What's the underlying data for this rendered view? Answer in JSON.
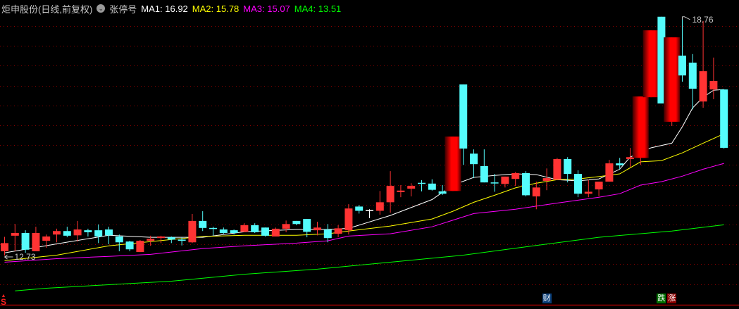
{
  "header": {
    "title": "炬申股份(日线,前复权)",
    "dropdown_icon": "chevron-down-icon",
    "indicator": "张停号",
    "ma_labels": [
      {
        "label": "MA1: 16.92",
        "color": "#ffffff"
      },
      {
        "label": "MA2: 15.78",
        "color": "#ffff00"
      },
      {
        "label": "MA3: 15.07",
        "color": "#ff00ff"
      },
      {
        "label": "MA4: 13.51",
        "color": "#00ff00"
      }
    ]
  },
  "labels": {
    "high": "18.76",
    "low": "12.73"
  },
  "markers": [
    {
      "text": "S",
      "candle": 0,
      "color": "#ff2020"
    },
    {
      "text": "财",
      "candle": 52,
      "color": "#0a3f7a"
    },
    {
      "text": "跌",
      "candle": 63,
      "color": "#007000"
    },
    {
      "text": "涨",
      "candle": 64,
      "color": "#8a0000"
    }
  ],
  "chart_data": {
    "type": "candlestick",
    "title": "炬申股份(日线,前复权)",
    "ylim": [
      11.79,
      19.3
    ],
    "grid": true,
    "colors": {
      "up": "#ff3333",
      "down": "#54fcfc",
      "flat": "#ffffff"
    },
    "high_label": "18.76",
    "low_label": "12.73",
    "limit_up_indices": [
      43,
      61,
      62,
      64
    ],
    "candles_ohlc": [
      [
        12.84,
        13.21,
        12.73,
        13.05
      ],
      [
        13.24,
        13.54,
        12.84,
        13.31
      ],
      [
        13.31,
        13.38,
        12.8,
        12.88
      ],
      [
        12.84,
        13.47,
        12.84,
        13.31
      ],
      [
        13.11,
        13.27,
        12.93,
        13.22
      ],
      [
        13.27,
        13.42,
        13.07,
        13.36
      ],
      [
        13.36,
        13.47,
        13.2,
        13.24
      ],
      [
        13.25,
        13.62,
        13.09,
        13.4
      ],
      [
        13.38,
        13.42,
        13.22,
        13.33
      ],
      [
        13.38,
        13.53,
        13.05,
        13.22
      ],
      [
        13.4,
        13.47,
        13.02,
        13.25
      ],
      [
        13.22,
        13.27,
        12.84,
        13.07
      ],
      [
        13.09,
        13.11,
        12.84,
        12.89
      ],
      [
        12.82,
        13.13,
        12.82,
        13.11
      ],
      [
        13.11,
        13.24,
        12.98,
        13.16
      ],
      [
        13.18,
        13.24,
        13.05,
        13.22
      ],
      [
        13.2,
        13.22,
        13.05,
        13.14
      ],
      [
        13.14,
        13.2,
        12.99,
        13.11
      ],
      [
        13.07,
        13.8,
        13.05,
        13.62
      ],
      [
        13.62,
        13.87,
        13.36,
        13.44
      ],
      [
        13.44,
        13.47,
        13.25,
        13.42
      ],
      [
        13.4,
        13.45,
        13.29,
        13.31
      ],
      [
        13.38,
        13.4,
        13.27,
        13.31
      ],
      [
        13.34,
        13.56,
        13.33,
        13.51
      ],
      [
        13.51,
        13.56,
        13.31,
        13.33
      ],
      [
        13.45,
        13.45,
        13.22,
        13.24
      ],
      [
        13.22,
        13.45,
        13.22,
        13.42
      ],
      [
        13.42,
        13.63,
        13.33,
        13.54
      ],
      [
        13.62,
        13.62,
        13.51,
        13.54
      ],
      [
        13.67,
        13.67,
        13.2,
        13.34
      ],
      [
        13.38,
        13.6,
        13.25,
        13.45
      ],
      [
        13.4,
        13.54,
        13.07,
        13.18
      ],
      [
        13.29,
        13.51,
        13.2,
        13.43
      ],
      [
        13.38,
        14.05,
        13.27,
        13.94
      ],
      [
        13.99,
        14.03,
        13.81,
        13.88
      ],
      [
        13.9,
        13.92,
        13.69,
        13.9
      ],
      [
        13.88,
        14.39,
        13.78,
        14.1
      ],
      [
        14.1,
        14.9,
        13.83,
        14.52
      ],
      [
        14.36,
        14.54,
        14.23,
        14.4
      ],
      [
        14.45,
        14.59,
        14.25,
        14.52
      ],
      [
        14.6,
        14.67,
        14.38,
        14.58
      ],
      [
        14.58,
        14.69,
        14.4,
        14.42
      ],
      [
        14.38,
        14.54,
        14.29,
        14.32
      ],
      [
        14.39,
        15.79,
        14.39,
        15.79
      ],
      [
        17.13,
        17.13,
        15.06,
        15.48
      ],
      [
        15.35,
        15.46,
        14.72,
        15.08
      ],
      [
        15.03,
        15.46,
        14.61,
        14.61
      ],
      [
        14.61,
        14.83,
        14.37,
        14.59
      ],
      [
        14.57,
        14.76,
        14.48,
        14.76
      ],
      [
        14.7,
        14.88,
        14.52,
        14.85
      ],
      [
        14.85,
        14.9,
        14.25,
        14.28
      ],
      [
        14.25,
        14.63,
        13.92,
        14.48
      ],
      [
        14.65,
        14.97,
        14.41,
        14.72
      ],
      [
        14.68,
        15.24,
        14.68,
        15.21
      ],
      [
        15.21,
        15.26,
        14.61,
        14.83
      ],
      [
        14.83,
        14.92,
        14.23,
        14.32
      ],
      [
        14.32,
        14.68,
        14.23,
        14.37
      ],
      [
        14.43,
        14.63,
        14.25,
        14.63
      ],
      [
        14.63,
        15.19,
        14.63,
        15.1
      ],
      [
        15.1,
        15.24,
        14.95,
        15.05
      ],
      [
        15.21,
        15.5,
        15.01,
        15.26
      ],
      [
        15.24,
        16.82,
        15.06,
        16.82
      ],
      [
        16.8,
        18.52,
        16.8,
        18.52
      ],
      [
        18.87,
        18.87,
        16.64,
        16.64
      ],
      [
        16.17,
        18.34,
        16.06,
        18.34
      ],
      [
        17.87,
        18.87,
        17.2,
        17.36
      ],
      [
        17.69,
        17.91,
        16.49,
        17.02
      ],
      [
        16.69,
        18.76,
        16.53,
        17.47
      ],
      [
        17.0,
        17.82,
        16.75,
        17.22
      ],
      [
        17.0,
        17.0,
        15.48,
        15.5
      ]
    ],
    "ma_series": [
      {
        "name": "MA1",
        "value": "16.92",
        "color": "#ffffff",
        "points": [
          [
            0,
            12.8
          ],
          [
            5,
            13.03
          ],
          [
            10,
            13.25
          ],
          [
            14,
            13.2
          ],
          [
            19,
            13.2
          ],
          [
            23,
            13.34
          ],
          [
            28,
            13.4
          ],
          [
            31,
            13.4
          ],
          [
            33,
            13.43
          ],
          [
            37,
            13.76
          ],
          [
            41,
            14.17
          ],
          [
            43,
            14.54
          ],
          [
            45,
            14.74
          ],
          [
            47,
            14.79
          ],
          [
            49,
            14.83
          ],
          [
            51,
            14.81
          ],
          [
            53,
            14.68
          ],
          [
            55,
            14.65
          ],
          [
            57,
            14.7
          ],
          [
            59,
            14.95
          ],
          [
            60,
            15.26
          ],
          [
            62,
            15.5
          ],
          [
            64,
            15.62
          ],
          [
            65,
            16.04
          ],
          [
            66,
            16.53
          ],
          [
            67,
            16.8
          ],
          [
            68,
            16.98
          ],
          [
            69,
            17.0
          ]
        ]
      },
      {
        "name": "MA2",
        "value": "15.78",
        "color": "#ffff00",
        "points": [
          [
            0,
            12.6
          ],
          [
            5,
            12.74
          ],
          [
            10,
            12.98
          ],
          [
            14,
            13.09
          ],
          [
            19,
            13.22
          ],
          [
            23,
            13.25
          ],
          [
            28,
            13.25
          ],
          [
            31,
            13.29
          ],
          [
            33,
            13.36
          ],
          [
            37,
            13.49
          ],
          [
            41,
            13.67
          ],
          [
            43,
            13.87
          ],
          [
            45,
            14.1
          ],
          [
            47,
            14.28
          ],
          [
            49,
            14.47
          ],
          [
            51,
            14.59
          ],
          [
            53,
            14.68
          ],
          [
            55,
            14.7
          ],
          [
            57,
            14.76
          ],
          [
            59,
            14.83
          ],
          [
            61,
            15.14
          ],
          [
            63,
            15.17
          ],
          [
            65,
            15.37
          ],
          [
            67,
            15.62
          ],
          [
            69,
            15.86
          ]
        ]
      },
      {
        "name": "MA3",
        "value": "15.07",
        "color": "#ff00ff",
        "points": [
          [
            0,
            12.56
          ],
          [
            5,
            12.65
          ],
          [
            10,
            12.71
          ],
          [
            14,
            12.76
          ],
          [
            19,
            12.91
          ],
          [
            23,
            12.98
          ],
          [
            28,
            13.05
          ],
          [
            31,
            13.11
          ],
          [
            33,
            13.23
          ],
          [
            37,
            13.29
          ],
          [
            41,
            13.47
          ],
          [
            45,
            13.81
          ],
          [
            49,
            13.92
          ],
          [
            53,
            14.08
          ],
          [
            57,
            14.23
          ],
          [
            59,
            14.32
          ],
          [
            61,
            14.54
          ],
          [
            63,
            14.63
          ],
          [
            65,
            14.77
          ],
          [
            67,
            14.95
          ],
          [
            69,
            15.1
          ]
        ]
      },
      {
        "name": "MA4",
        "value": "13.51",
        "color": "#00ff00",
        "points": [
          [
            1,
            11.82
          ],
          [
            4,
            11.89
          ],
          [
            10,
            11.98
          ],
          [
            16,
            12.07
          ],
          [
            23,
            12.25
          ],
          [
            30,
            12.38
          ],
          [
            37,
            12.56
          ],
          [
            44,
            12.74
          ],
          [
            49,
            12.92
          ],
          [
            57,
            13.2
          ],
          [
            64,
            13.36
          ],
          [
            69,
            13.52
          ]
        ]
      }
    ]
  }
}
